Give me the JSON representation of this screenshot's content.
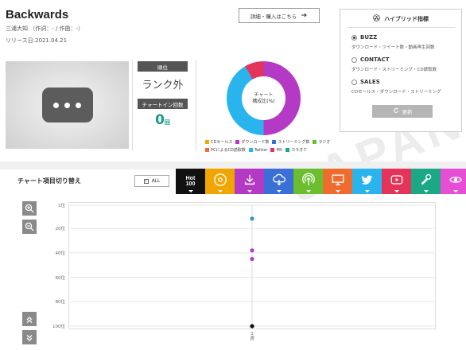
{
  "song": {
    "title": "Backwards",
    "credit": "三浦大知 （作詞：- / 作曲：-）",
    "release": "リリース日:2021.04.21"
  },
  "detail_button": {
    "label": "詳細・購入はこちら",
    "icon": "arrow-right-icon"
  },
  "video": {
    "icon": "ellipsis-icon"
  },
  "rank": {
    "label": "順位",
    "value": "ランク外"
  },
  "chart_in": {
    "label": "チャートイン回数",
    "value": "0",
    "unit": "回"
  },
  "donut": {
    "line1": "チャート",
    "line2": "構成比(%)",
    "segments": [
      {
        "name": "ダウンロード数",
        "color": "#b43ac6"
      },
      {
        "name": "Twitter",
        "color": "#2ab4ee"
      },
      {
        "name": "MV",
        "color": "#e5345a"
      }
    ]
  },
  "legend": [
    {
      "label": "CDセールス",
      "color": "#f0a500"
    },
    {
      "label": "ダウンロード数",
      "color": "#b43ac6"
    },
    {
      "label": "ストリーミング数",
      "color": "#3a6fd8"
    },
    {
      "label": "ラジオ",
      "color": "#6bbf2e"
    },
    {
      "label": "PCによるCD読取数",
      "color": "#ef6b2e"
    },
    {
      "label": "Twitter",
      "color": "#2ab4ee"
    },
    {
      "label": "MV",
      "color": "#e5345a"
    },
    {
      "label": "カラオケ",
      "color": "#1aa886"
    }
  ],
  "hybrid": {
    "title": "ハイブリッド指標",
    "icon": "hybrid-icon",
    "options": [
      {
        "label": "BUZZ",
        "desc": "ダウンロード・ツイート数・動画再生回数",
        "selected": true
      },
      {
        "label": "CONTACT",
        "desc": "ダウンロード・ストリーミング・CD読取数",
        "selected": false
      },
      {
        "label": "SALES",
        "desc": "CDセールス・ダウンロード・ストリーミング",
        "selected": false
      }
    ],
    "update_label": "更新"
  },
  "chart_switch": {
    "label": "チャート項目切り替え",
    "all_label": "ALL",
    "tabs": [
      {
        "name": "hot100",
        "color": "#111111",
        "line1": "Hot",
        "line2": "100"
      },
      {
        "name": "cd-sales",
        "color": "#f0a500",
        "icon": "cd-icon"
      },
      {
        "name": "download",
        "color": "#b43ac6",
        "icon": "download-icon"
      },
      {
        "name": "streaming",
        "color": "#3a6fd8",
        "icon": "streaming-icon"
      },
      {
        "name": "radio",
        "color": "#6bbf2e",
        "icon": "radio-icon"
      },
      {
        "name": "pc-cd-read",
        "color": "#ef6b2e",
        "icon": "pc-icon"
      },
      {
        "name": "twitter",
        "color": "#2ab4ee",
        "icon": "twitter-icon"
      },
      {
        "name": "mv",
        "color": "#e5345a",
        "icon": "play-icon"
      },
      {
        "name": "karaoke",
        "color": "#1aa886",
        "icon": "microphone-icon"
      },
      {
        "name": "lookup",
        "color": "#e64fd4",
        "icon": "eye-icon"
      }
    ]
  },
  "chart_data": {
    "type": "scatter",
    "title": "",
    "y_ticks": [
      "1位",
      "20位",
      "40位",
      "60位",
      "80位",
      "100位"
    ],
    "ylim": [
      1,
      100
    ],
    "y_inverted": true,
    "x_ticks": [
      {
        "line1": "1",
        "line2": "週"
      }
    ],
    "grid": true,
    "series": [
      {
        "color": "#3399cc",
        "points": [
          {
            "x": 1,
            "y": 12
          }
        ]
      },
      {
        "color": "#b43ac6",
        "points": [
          {
            "x": 1,
            "y": 38
          },
          {
            "x": 1,
            "y": 45
          }
        ]
      },
      {
        "color": "#111111",
        "points": [
          {
            "x": 1,
            "y": 100
          }
        ]
      }
    ]
  }
}
